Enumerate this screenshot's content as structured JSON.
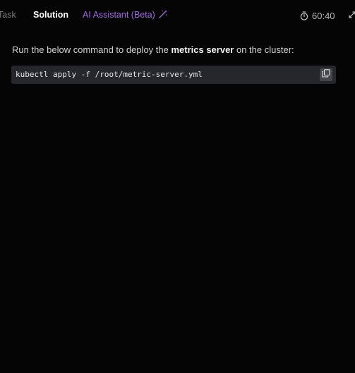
{
  "tabs": {
    "task": "Task",
    "solution": "Solution",
    "ai_assistant": "AI Assistant (Beta)"
  },
  "timer": {
    "value": "60:40"
  },
  "instruction": {
    "prefix": "Run the below command to deploy the ",
    "bold": "metrics server",
    "suffix": " on the cluster:"
  },
  "code": {
    "command": "kubectl apply -f /root/metric-server.yml"
  },
  "icons": {
    "ai": "magic-wand-icon",
    "timer": "stopwatch-icon",
    "expand": "expand-icon",
    "copy": "copy-icon"
  },
  "colors": {
    "background": "#050505",
    "ai_accent": "#a268e6",
    "code_bg": "#26272c"
  }
}
